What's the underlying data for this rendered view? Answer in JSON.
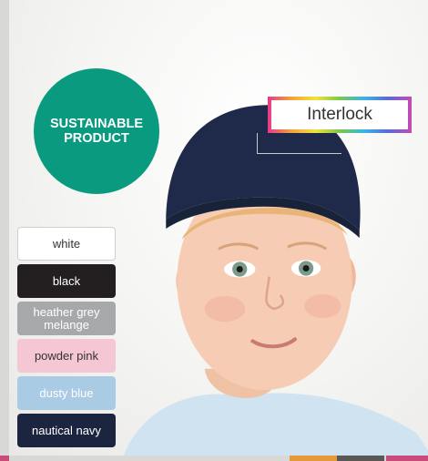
{
  "badge": {
    "line1": "SUSTAINABLE",
    "line2": "PRODUCT",
    "color": "#0a9a80"
  },
  "fabric_label": "Interlock",
  "swatches": [
    {
      "label": "white",
      "bg": "#ffffff",
      "fg": "#333333"
    },
    {
      "label": "black",
      "bg": "#231f20",
      "fg": "#ffffff"
    },
    {
      "label": "heather grey melange",
      "bg": "#a7a8aa",
      "fg": "#ffffff"
    },
    {
      "label": "powder pink",
      "bg": "#f5c6d3",
      "fg": "#333333"
    },
    {
      "label": "dusty blue",
      "bg": "#a9cbe3",
      "fg": "#ffffff"
    },
    {
      "label": "nautical navy",
      "bg": "#1c2540",
      "fg": "#ffffff"
    }
  ],
  "bottom_colors": [
    "#c84b7a",
    "#e59a3a",
    "#5a5856",
    "#c84b7a"
  ]
}
